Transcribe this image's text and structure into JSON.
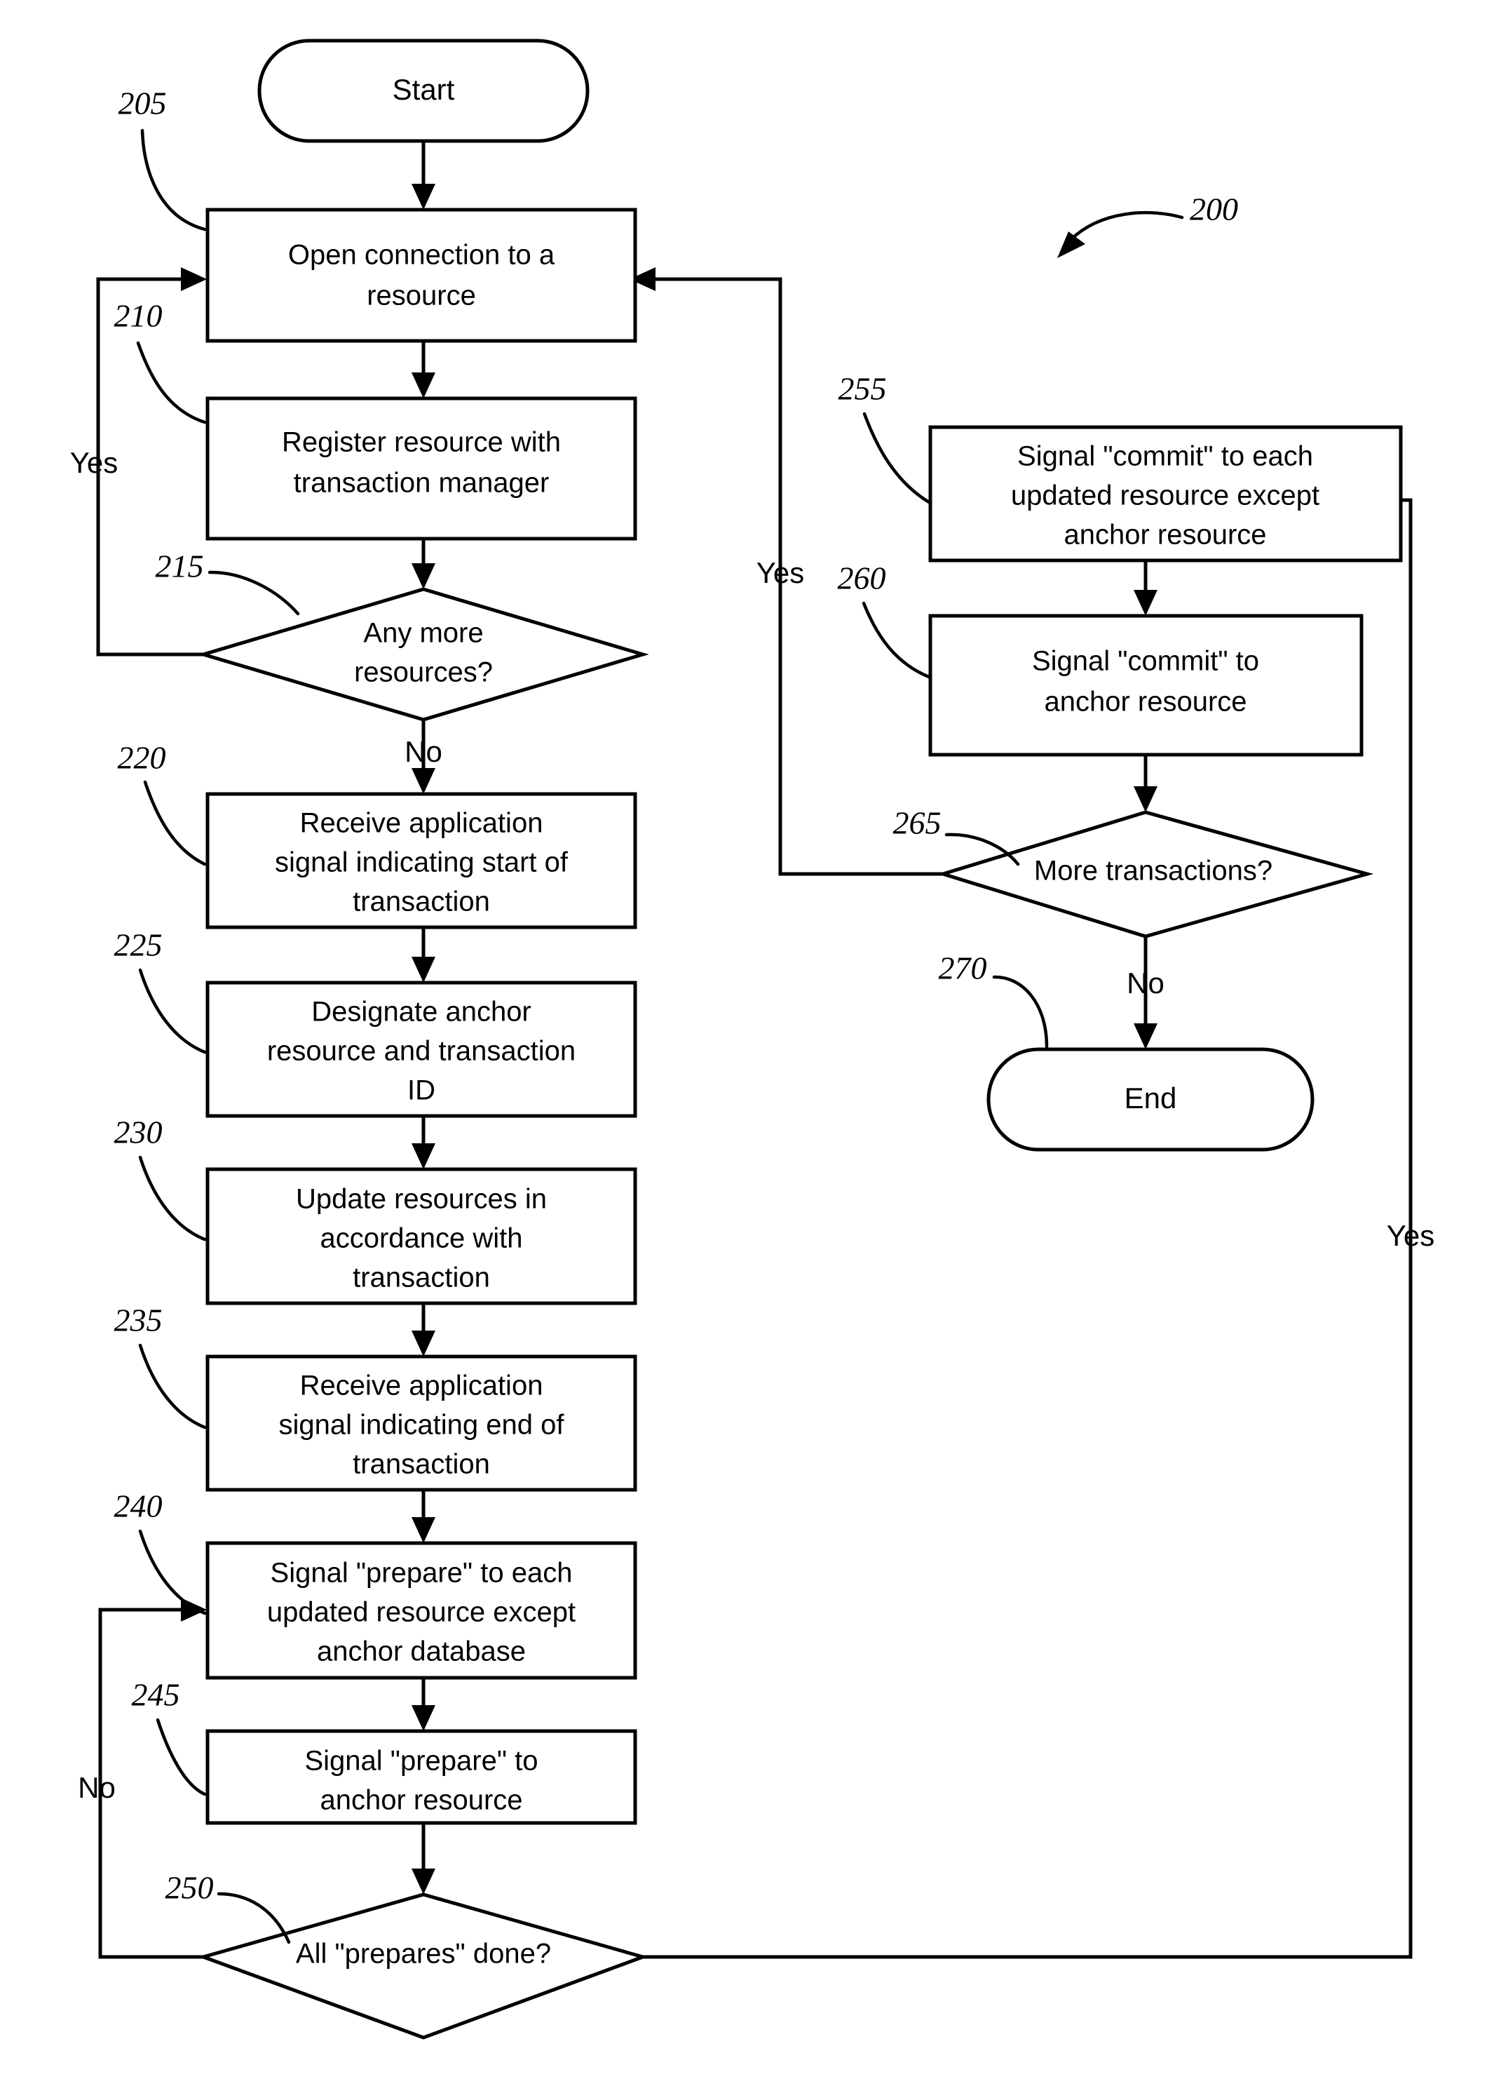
{
  "figure": {
    "number": "200",
    "type": "flowchart"
  },
  "nodes": {
    "start": {
      "ref": "",
      "shape": "terminal",
      "lines": [
        "Start"
      ]
    },
    "n205": {
      "ref": "205",
      "shape": "process",
      "lines": [
        "Open connection to a",
        "resource"
      ]
    },
    "n210": {
      "ref": "210",
      "shape": "process",
      "lines": [
        "Register resource with",
        "transaction manager"
      ]
    },
    "n215": {
      "ref": "215",
      "shape": "decision",
      "lines": [
        "Any more",
        "resources?"
      ]
    },
    "n220": {
      "ref": "220",
      "shape": "process",
      "lines": [
        "Receive application",
        "signal indicating start of",
        "transaction"
      ]
    },
    "n225": {
      "ref": "225",
      "shape": "process",
      "lines": [
        "Designate anchor",
        "resource and transaction",
        "ID"
      ]
    },
    "n230": {
      "ref": "230",
      "shape": "process",
      "lines": [
        "Update resources in",
        "accordance with",
        "transaction"
      ]
    },
    "n235": {
      "ref": "235",
      "shape": "process",
      "lines": [
        "Receive application",
        "signal indicating end of",
        "transaction"
      ]
    },
    "n240": {
      "ref": "240",
      "shape": "process",
      "lines": [
        "Signal \"prepare\" to each",
        "updated resource except",
        "anchor database"
      ]
    },
    "n245": {
      "ref": "245",
      "shape": "process",
      "lines": [
        "Signal \"prepare\" to",
        "anchor resource"
      ]
    },
    "n250": {
      "ref": "250",
      "shape": "decision",
      "lines": [
        "All \"prepares\" done?"
      ]
    },
    "n255": {
      "ref": "255",
      "shape": "process",
      "lines": [
        "Signal \"commit\" to each",
        "updated resource except",
        "anchor resource"
      ]
    },
    "n260": {
      "ref": "260",
      "shape": "process",
      "lines": [
        "Signal \"commit\" to",
        "anchor resource"
      ]
    },
    "n265": {
      "ref": "265",
      "shape": "decision",
      "lines": [
        "More transactions?"
      ]
    },
    "n270": {
      "ref": "270",
      "shape": "terminal",
      "lines": [
        "End"
      ]
    }
  },
  "edge_labels": {
    "yes_215_loop": "Yes",
    "no_215_down": "No",
    "no_250_loop": "No",
    "yes_250_right": "Yes",
    "yes_265_loop": "Yes",
    "no_265_end": "No"
  }
}
